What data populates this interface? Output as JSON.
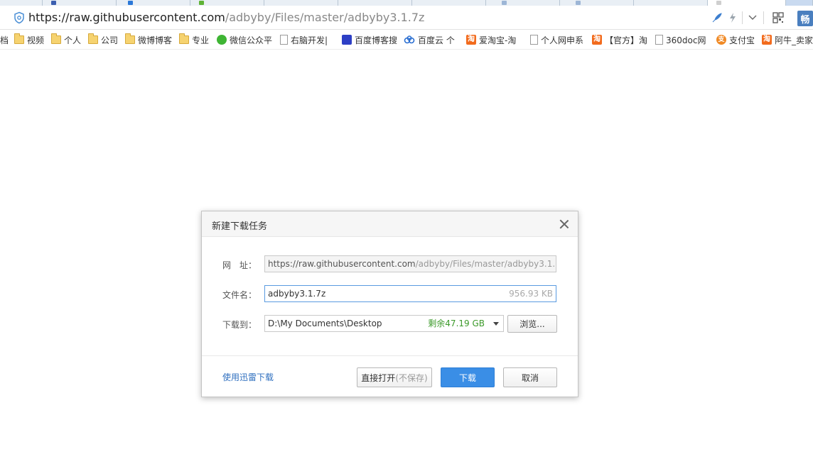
{
  "address_bar": {
    "url_dark": "https://raw.githubusercontent.com",
    "url_light": "/adbyby/Files/master/adbyby3.1.7z",
    "user_badge": "畅"
  },
  "bookmarks": [
    {
      "label": "档",
      "icon": "none"
    },
    {
      "label": "视频",
      "icon": "folder-icon"
    },
    {
      "label": "个人",
      "icon": "folder-icon"
    },
    {
      "label": "公司",
      "icon": "folder-icon"
    },
    {
      "label": "微博博客",
      "icon": "folder-icon"
    },
    {
      "label": "专业",
      "icon": "folder-icon"
    },
    {
      "label": "微信公众平",
      "icon": "wechat-icon"
    },
    {
      "label": "右脑开发|",
      "icon": "page-icon"
    },
    {
      "label": "百度博客搜",
      "icon": "baidu-icon"
    },
    {
      "label": "百度云 个",
      "icon": "cloud-icon"
    },
    {
      "label": "爱淘宝-淘",
      "icon": "taobao-icon"
    },
    {
      "label": "个人网申系",
      "icon": "page-icon"
    },
    {
      "label": "【官方】淘",
      "icon": "taobao-icon"
    },
    {
      "label": "360doc网",
      "icon": "page-icon"
    },
    {
      "label": "支付宝",
      "icon": "alipay-icon"
    },
    {
      "label": "阿牛_卖家",
      "icon": "taobao-icon"
    }
  ],
  "dialog": {
    "title": "新建下载任务",
    "url_label": "网　址：",
    "url_dark": "https://raw.githubusercontent.com",
    "url_light": "/adbyby/Files/master/adbyby3.1.7z",
    "filename_label": "文件名：",
    "filename_value": "adbyby3.1.7z",
    "filesize": "956.93 KB",
    "saveto_label": "下载到：",
    "saveto_value": "D:\\My Documents\\Desktop",
    "free_space": "剩余47.19 GB",
    "browse_label": "浏览...",
    "thunder_link": "使用迅雷下载",
    "open_direct_label": "直接打开",
    "open_direct_note": "(不保存)",
    "download_label": "下载",
    "cancel_label": "取消"
  },
  "colors": {
    "accent": "#3a8ee6",
    "link": "#2f6fbf",
    "free_space": "#3c9a2a"
  }
}
